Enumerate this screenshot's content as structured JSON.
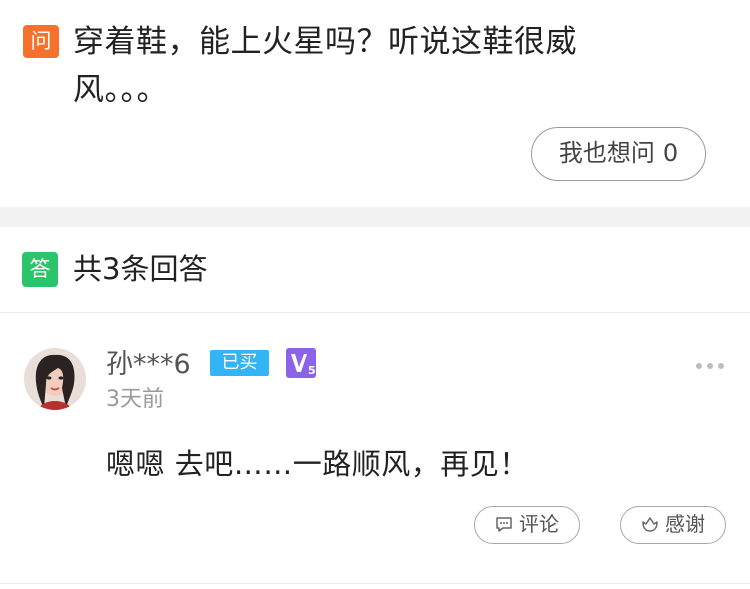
{
  "question": {
    "badge": "问",
    "text": "穿着鞋，能上火星吗？听说这鞋很威风。。。",
    "ask_button_label": "我也想问",
    "ask_count": "0"
  },
  "answers_header": {
    "badge": "答",
    "title": "共3条回答"
  },
  "answer": {
    "username": "孙***6",
    "bought_tag": "已买",
    "vip_level": "5",
    "time": "3天前",
    "text": "嗯嗯 去吧……一路顺风，再见！",
    "comment_label": "评论",
    "thanks_label": "感谢"
  },
  "colors": {
    "question_badge": "#f6722c",
    "answer_badge": "#2bc46b",
    "bought_tag": "#33b4f4",
    "vip_badge": "#8b63e6"
  },
  "icons": {
    "more": "more-dots-icon",
    "comment": "comment-icon",
    "thanks": "thanks-flower-icon",
    "vip": "vip-level-icon"
  }
}
